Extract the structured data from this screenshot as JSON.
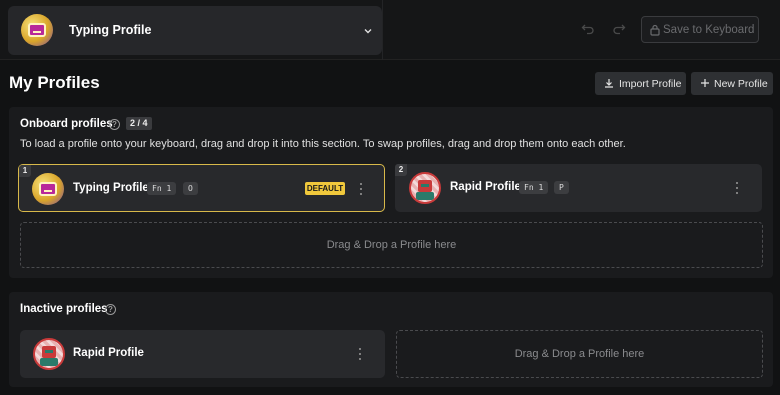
{
  "header": {
    "current_profile": "Typing Profile",
    "save_label": "Save to Keyboard"
  },
  "page": {
    "title": "My Profiles",
    "import_label": "Import Profile",
    "new_label": "New Profile"
  },
  "onboard": {
    "title": "Onboard profiles",
    "count": "2 / 4",
    "description": "To load a profile onto your keyboard, drag and drop it into this section. To swap profiles, drag and drop them onto each other.",
    "cards": [
      {
        "slot": "1",
        "name": "Typing Profile",
        "keys": [
          "Fn 1",
          "O"
        ],
        "badge": "DEFAULT"
      },
      {
        "slot": "2",
        "name": "Rapid Profile",
        "keys": [
          "Fn 1",
          "P"
        ]
      }
    ],
    "dropzone": "Drag & Drop a Profile here"
  },
  "inactive": {
    "title": "Inactive profiles",
    "cards": [
      {
        "name": "Rapid Profile"
      }
    ],
    "dropzone": "Drag & Drop a Profile here"
  },
  "icons": {
    "help": "?"
  },
  "colors": {
    "selected_border": "#d8b94a",
    "default_badge": "#f0c83c"
  }
}
